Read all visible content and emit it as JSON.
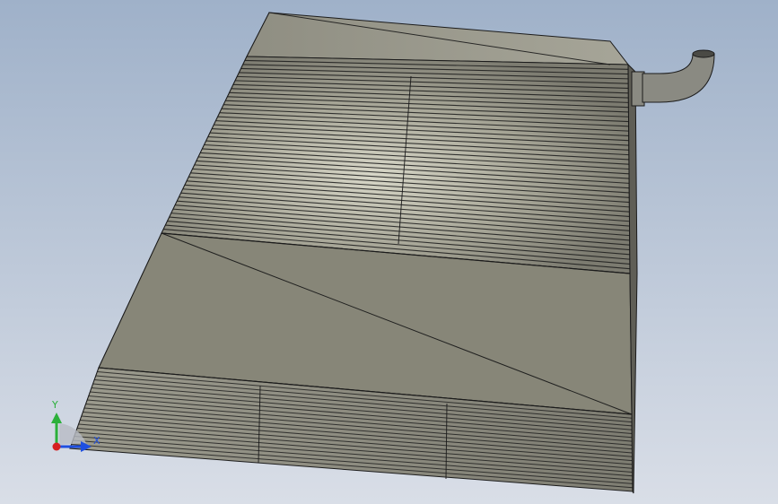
{
  "viewport": {
    "background_top": "#9fb1c9",
    "background_bottom": "#d9dee7"
  },
  "model": {
    "face_color": "#8d8c80",
    "light_face_color": "#c9c8b8",
    "edge_color": "#1b1b1b",
    "pipe_color": "#8a8a82"
  },
  "triad": {
    "y_label": "Y",
    "x_label": "X",
    "y_color": "#2bb03a",
    "x_color": "#1f4fe0",
    "origin_color": "#d62020",
    "icon": "coordinate-triad-icon"
  }
}
